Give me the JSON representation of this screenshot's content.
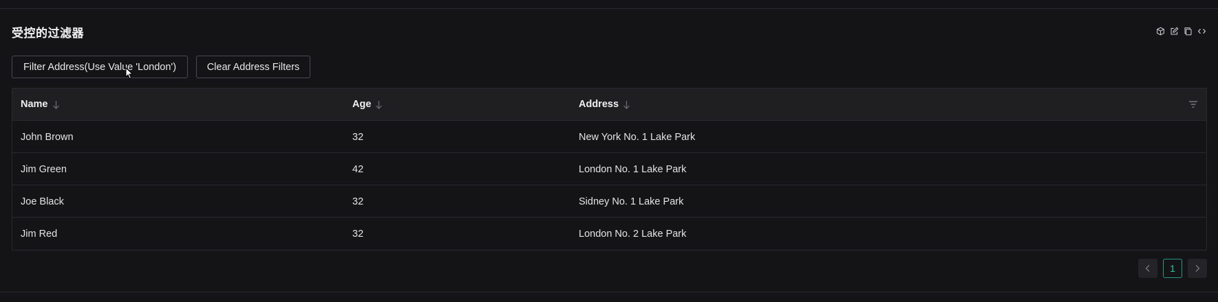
{
  "demo": {
    "title": "受控的过滤器"
  },
  "toolbar_icons": [
    "codesandbox-icon",
    "edit-icon",
    "copy-icon",
    "code-icon"
  ],
  "buttons": {
    "filter_label": "Filter Address(Use Value 'London')",
    "clear_label": "Clear Address Filters"
  },
  "table": {
    "columns": [
      "Name",
      "Age",
      "Address"
    ],
    "rows": [
      {
        "name": "John Brown",
        "age": "32",
        "address": "New York No. 1 Lake Park"
      },
      {
        "name": "Jim Green",
        "age": "42",
        "address": "London No. 1 Lake Park"
      },
      {
        "name": "Joe Black",
        "age": "32",
        "address": "Sidney No. 1 Lake Park"
      },
      {
        "name": "Jim Red",
        "age": "32",
        "address": "London No. 2 Lake Park"
      }
    ]
  },
  "pagination": {
    "current_page": "1",
    "prev_icon": "chevron-left-icon",
    "next_icon": "chevron-right-icon"
  },
  "colors": {
    "background": "#141416",
    "accent": "#2bc7a8",
    "border": "#2a2a2e"
  }
}
